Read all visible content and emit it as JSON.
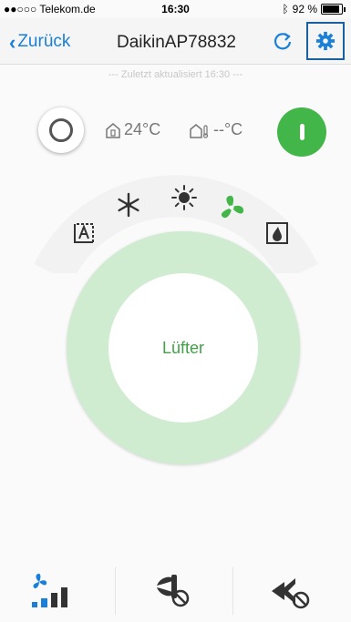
{
  "status_bar": {
    "carrier": "●●○○○ Telekom.de",
    "time": "16:30",
    "battery": "92 %"
  },
  "nav": {
    "back_label": "Zurück",
    "title": "DaikinAP78832"
  },
  "updated_text": "--- Zuletzt aktualisiert 16:30 ---",
  "temperatures": {
    "indoor": "24°C",
    "outdoor": "--°C"
  },
  "power": {
    "state": "on"
  },
  "modes": {
    "items": [
      "auto",
      "cool",
      "heat",
      "fan",
      "dry"
    ],
    "selected": "fan"
  },
  "dial": {
    "label": "Lüfter"
  },
  "colors": {
    "accent_blue": "#1a7fd6",
    "active_green": "#43b649",
    "dial_green": "#cfebd0",
    "text_gray": "#777777"
  }
}
